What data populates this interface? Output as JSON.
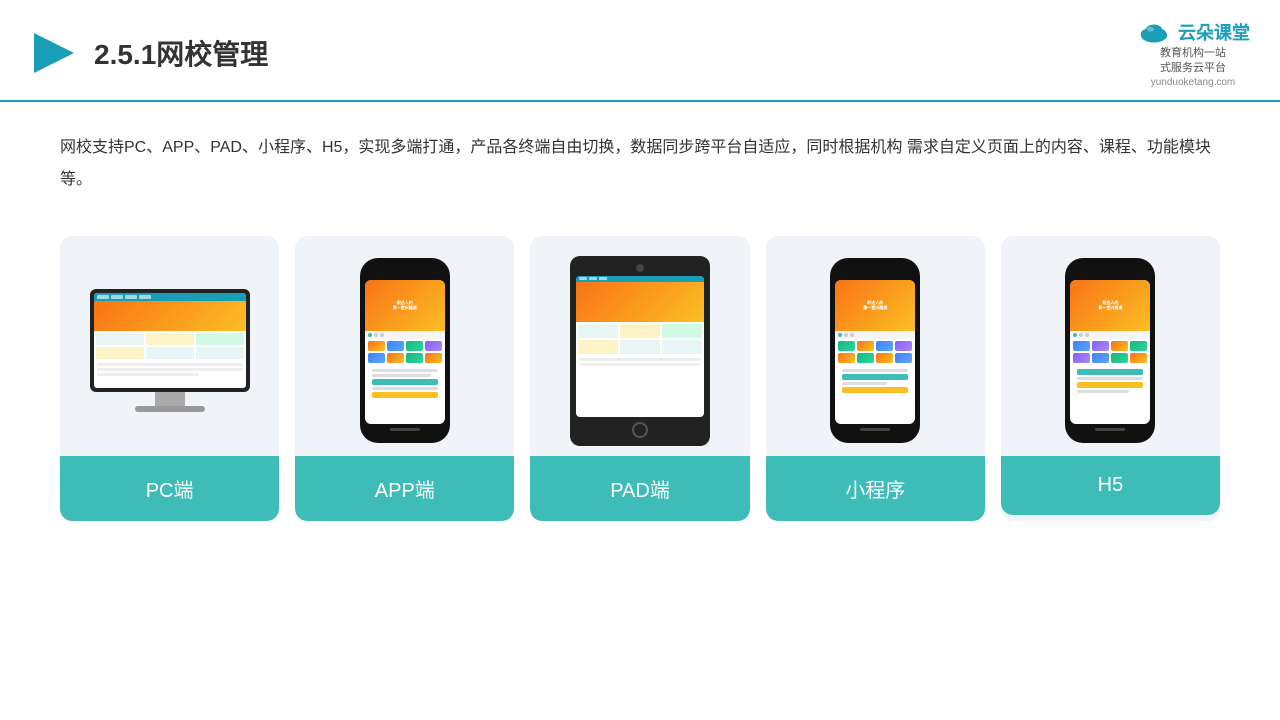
{
  "header": {
    "title": "2.5.1网校管理",
    "logo": {
      "main": "云朵课堂",
      "tagline": "教育机构一站\n式服务云平台",
      "url": "yunduoketang.com"
    }
  },
  "description": "网校支持PC、APP、PAD、小程序、H5，实现多端打通，产品各终端自由切换，数据同步跨平台自适应，同时根据机构\n需求自定义页面上的内容、课程、功能模块等。",
  "cards": [
    {
      "id": "pc",
      "label": "PC端",
      "type": "monitor"
    },
    {
      "id": "app",
      "label": "APP端",
      "type": "phone"
    },
    {
      "id": "pad",
      "label": "PAD端",
      "type": "tablet"
    },
    {
      "id": "miniprogram",
      "label": "小程序",
      "type": "phone"
    },
    {
      "id": "h5",
      "label": "H5",
      "type": "phone"
    }
  ],
  "colors": {
    "accent": "#3dbcb8",
    "header_border": "#1a9eb8",
    "title": "#333333",
    "background": "#ffffff",
    "card_bg": "#f0f4f8"
  }
}
